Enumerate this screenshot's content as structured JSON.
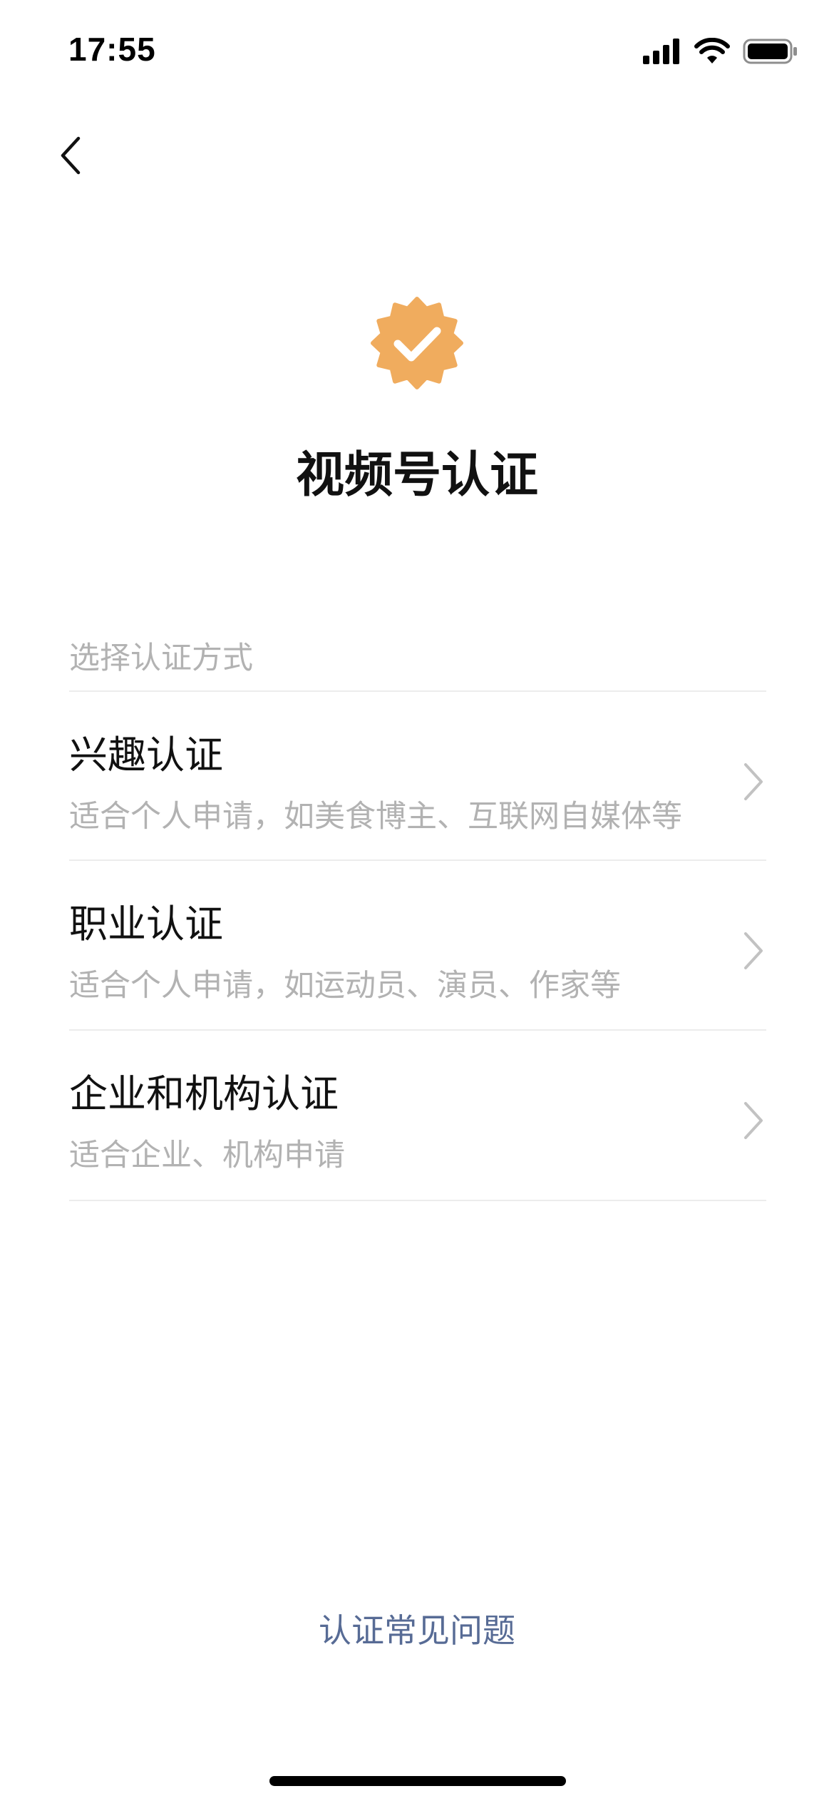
{
  "status_bar": {
    "time": "17:55",
    "icons": [
      "signal-icon",
      "wifi-icon",
      "battery-icon"
    ]
  },
  "header": {
    "back_icon": "chevron-left-icon"
  },
  "badge": {
    "icon": "verified-badge-icon",
    "color": "#F0AC5E"
  },
  "page": {
    "title": "视频号认证"
  },
  "section": {
    "label": "选择认证方式"
  },
  "options": [
    {
      "title": "兴趣认证",
      "description": "适合个人申请，如美食博主、互联网自媒体等"
    },
    {
      "title": "职业认证",
      "description": "适合个人申请，如运动员、演员、作家等"
    },
    {
      "title": "企业和机构认证",
      "description": "适合企业、机构申请"
    }
  ],
  "footer": {
    "faq_link": "认证常见问题",
    "link_color": "#576B95"
  }
}
